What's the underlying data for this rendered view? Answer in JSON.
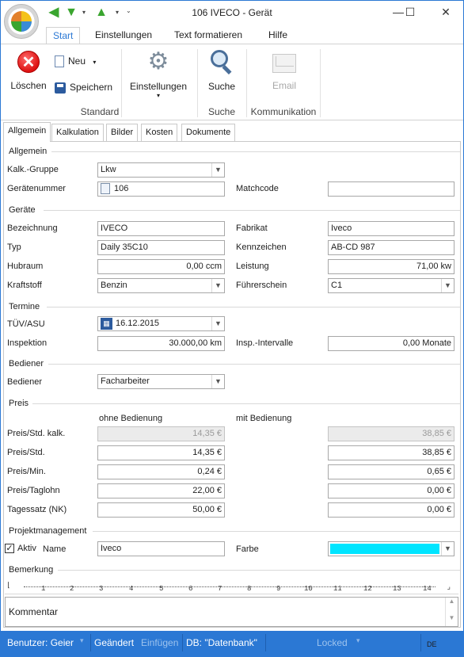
{
  "window": {
    "title": "106 IVECO - Gerät",
    "controls": {
      "minimize": "—",
      "maximize": "☐",
      "close": "✕"
    }
  },
  "quick_access": {
    "icons": [
      "back-arrow-icon",
      "down-arrow-icon",
      "up-arrow-icon"
    ]
  },
  "ribbon": {
    "tabs": [
      "Start",
      "Einstellungen",
      "Text formatieren",
      "Hilfe"
    ],
    "active_tab": "Start",
    "buttons": {
      "delete": "Löschen",
      "new": "Neu",
      "save": "Speichern",
      "settings": "Einstellungen",
      "search": "Suche",
      "email": "Email"
    },
    "groups": {
      "standard": "Standard",
      "suche": "Suche",
      "kommunikation": "Kommunikation"
    }
  },
  "doc_tabs": [
    "Allgemein",
    "Kalkulation",
    "Bilder",
    "Kosten",
    "Dokumente"
  ],
  "active_doc_tab": "Allgemein",
  "allgemein": {
    "section_title": "Allgemein",
    "kalk_gruppe_label": "Kalk.-Gruppe",
    "kalk_gruppe_value": "Lkw",
    "geraetenummer_label": "Gerätenummer",
    "geraetenummer_value": "106",
    "matchcode_label": "Matchcode",
    "matchcode_value": ""
  },
  "geraete": {
    "section_title": "Geräte",
    "bezeichnung_label": "Bezeichnung",
    "bezeichnung_value": "IVECO",
    "fabrikat_label": "Fabrikat",
    "fabrikat_value": "Iveco",
    "typ_label": "Typ",
    "typ_value": "Daily 35C10",
    "kennzeichen_label": "Kennzeichen",
    "kennzeichen_value": "AB-CD 987",
    "hubraum_label": "Hubraum",
    "hubraum_value": "0,00 ccm",
    "leistung_label": "Leistung",
    "leistung_value": "71,00 kw",
    "kraftstoff_label": "Kraftstoff",
    "kraftstoff_value": "Benzin",
    "fuehrerschein_label": "Führerschein",
    "fuehrerschein_value": "C1"
  },
  "termine": {
    "section_title": "Termine",
    "tuev_label": "TÜV/ASU",
    "tuev_value": "16.12.2015",
    "inspektion_label": "Inspektion",
    "inspektion_value": "30.000,00 km",
    "insp_intervalle_label": "Insp.-Intervalle",
    "insp_intervalle_value": "0,00 Monate"
  },
  "bediener": {
    "section_title": "Bediener",
    "bediener_label": "Bediener",
    "bediener_value": "Facharbeiter"
  },
  "preis": {
    "section_title": "Preis",
    "col_ohne": "ohne Bedienung",
    "col_mit": "mit Bedienung",
    "rows": [
      {
        "label": "Preis/Std. kalk.",
        "ohne": "14,35 €",
        "mit": "38,85 €"
      },
      {
        "label": "Preis/Std.",
        "ohne": "14,35 €",
        "mit": "38,85 €"
      },
      {
        "label": "Preis/Min.",
        "ohne": "0,24 €",
        "mit": "0,65 €"
      },
      {
        "label": "Preis/Taglohn",
        "ohne": "22,00 €",
        "mit": "0,00 €"
      },
      {
        "label": "Tagessatz (NK)",
        "ohne": "50,00 €",
        "mit": "0,00 €"
      }
    ]
  },
  "projekt": {
    "section_title": "Projektmanagement",
    "aktiv_label": "Aktiv",
    "aktiv_checked": true,
    "name_label": "Name",
    "name_value": "Iveco",
    "farbe_label": "Farbe",
    "farbe_color": "#00e5ff"
  },
  "bemerkung": {
    "section_title": "Bemerkung",
    "ruler_ticks": [
      "1",
      "2",
      "3",
      "4",
      "5",
      "6",
      "7",
      "8",
      "9",
      "10",
      "11",
      "12",
      "13",
      "14"
    ],
    "text": "Kommentar"
  },
  "status": {
    "user": "Benutzer: Geier",
    "changed": "Geändert",
    "insert": "Einfügen",
    "db": "DB: \"Datenbank\"",
    "locked": "Locked",
    "lang": "DE"
  }
}
